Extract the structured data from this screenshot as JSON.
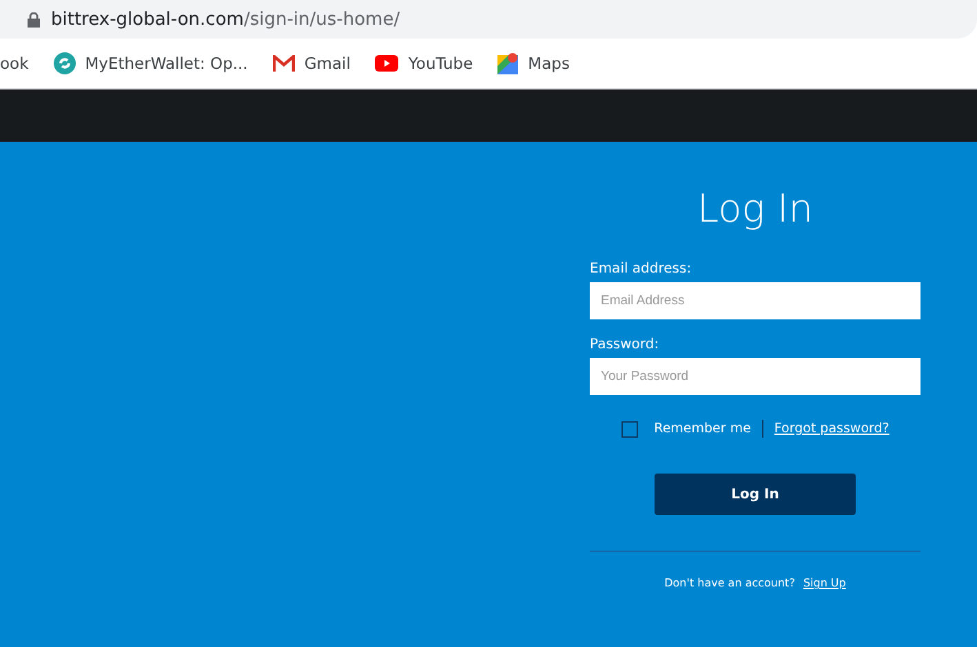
{
  "browser": {
    "url_host": "bittrex-global-on.com",
    "url_path": "/sign-in/us-home/"
  },
  "bookmarks": [
    {
      "kind": "plain",
      "label": "ook"
    },
    {
      "kind": "wallet",
      "label": "MyEtherWallet: Op..."
    },
    {
      "kind": "mail",
      "label": "Gmail"
    },
    {
      "kind": "video",
      "label": "YouTube"
    },
    {
      "kind": "map",
      "label": "Maps"
    }
  ],
  "login": {
    "title": "Log In",
    "fields": [
      {
        "label": "Email address:",
        "placeholder": "Email Address"
      },
      {
        "label": "Password:",
        "placeholder": "Your Password"
      }
    ],
    "remember_me": {
      "label": "Remember me",
      "checked": false
    },
    "forgot_link": "Forgot password?",
    "submit": "Log In",
    "signup_prompt": "Don't have an account?",
    "signup_link": "Sign Up"
  }
}
